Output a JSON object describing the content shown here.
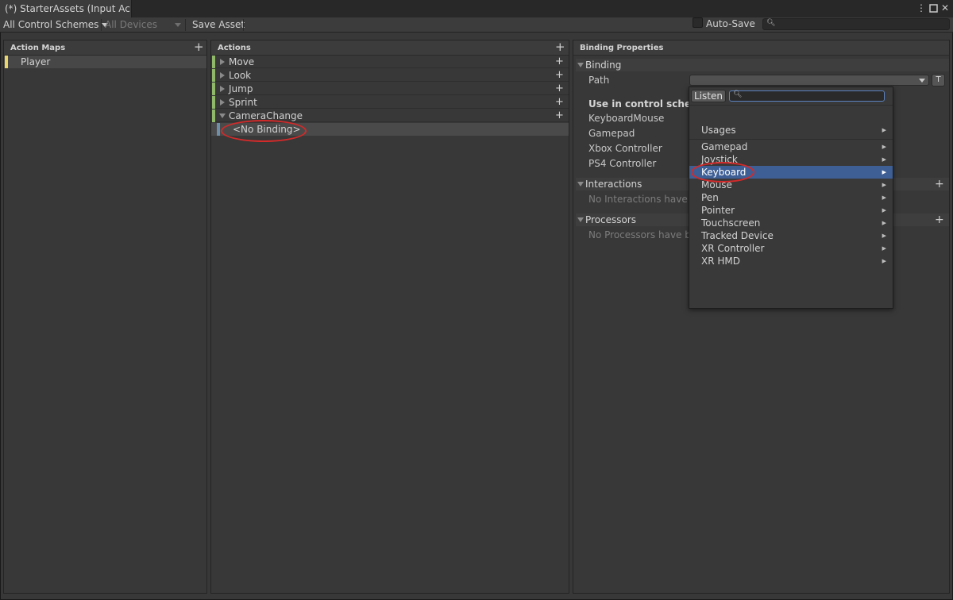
{
  "window": {
    "tab_title": "(*) StarterAssets (Input Ac...",
    "buttons": {
      "menu": "⋮",
      "maximize": "□",
      "close": "✕"
    }
  },
  "toolbar": {
    "control_schemes": "All Control Schemes",
    "devices": "All Devices",
    "save_asset": "Save Asset",
    "auto_save": "Auto-Save",
    "search_placeholder": ""
  },
  "action_maps": {
    "header": "Action Maps",
    "items": [
      {
        "label": "Player",
        "color": "#e8d66c"
      }
    ]
  },
  "actions": {
    "header": "Actions",
    "items": [
      {
        "label": "Move",
        "expanded": false
      },
      {
        "label": "Look",
        "expanded": false
      },
      {
        "label": "Jump",
        "expanded": false
      },
      {
        "label": "Sprint",
        "expanded": false
      },
      {
        "label": "CameraChange",
        "expanded": true
      }
    ],
    "binding": "<No Binding>",
    "action_color": "#8fb86b",
    "binding_color": "#6d8fa7"
  },
  "binding_properties": {
    "header": "Binding Properties",
    "binding_section": "Binding",
    "path_label": "Path",
    "use_in_control_schemes": "Use in control scheme",
    "schemes": [
      "KeyboardMouse",
      "Gamepad",
      "Xbox Controller",
      "PS4 Controller"
    ],
    "interactions_section": "Interactions",
    "interactions_empty": "No Interactions have be",
    "processors_section": "Processors",
    "processors_empty": "No Processors have bee",
    "t_button": "T"
  },
  "path_popup": {
    "listen_button": "Listen",
    "search_value": "",
    "usages": "Usages",
    "devices": [
      "Gamepad",
      "Joystick",
      "Keyboard",
      "Mouse",
      "Pen",
      "Pointer",
      "Touchscreen",
      "Tracked Device",
      "XR Controller",
      "XR HMD"
    ],
    "selected": "Keyboard",
    "selected_color": "#3e5f96"
  },
  "annotation_color": "#d32a2a"
}
